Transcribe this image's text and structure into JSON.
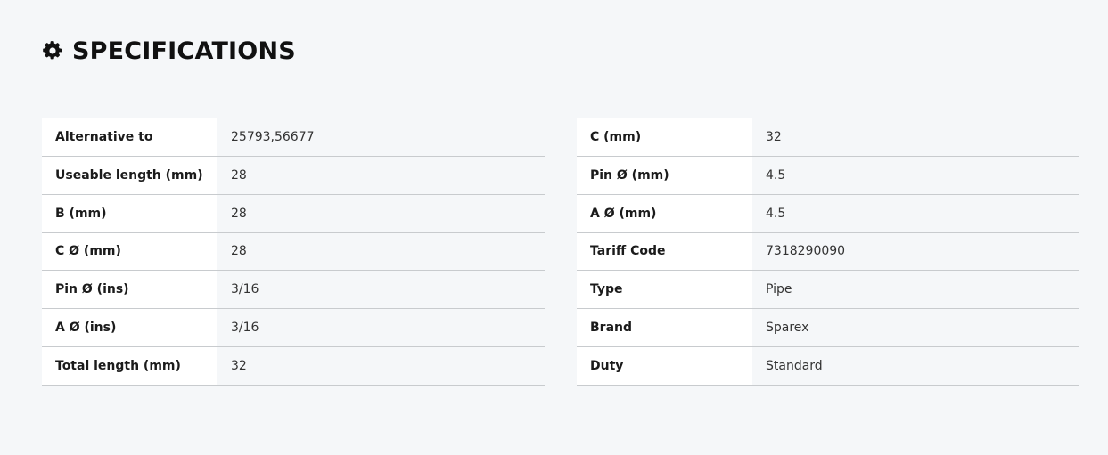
{
  "header": {
    "icon": "gear-icon",
    "title": "SPECIFICATIONS"
  },
  "specs_left": [
    {
      "label": "Alternative to",
      "value": "25793,56677"
    },
    {
      "label": "Useable length (mm)",
      "value": "28"
    },
    {
      "label": "B (mm)",
      "value": "28"
    },
    {
      "label": "C Ø (mm)",
      "value": "28"
    },
    {
      "label": "Pin Ø (ins)",
      "value": "3/16"
    },
    {
      "label": "A Ø (ins)",
      "value": "3/16"
    },
    {
      "label": "Total length (mm)",
      "value": "32"
    }
  ],
  "specs_right": [
    {
      "label": "C (mm)",
      "value": "32"
    },
    {
      "label": "Pin Ø (mm)",
      "value": "4.5"
    },
    {
      "label": "A Ø (mm)",
      "value": "4.5"
    },
    {
      "label": "Tariff Code",
      "value": "7318290090"
    },
    {
      "label": "Type",
      "value": "Pipe"
    },
    {
      "label": "Brand",
      "value": "Sparex"
    },
    {
      "label": "Duty",
      "value": "Standard"
    }
  ]
}
